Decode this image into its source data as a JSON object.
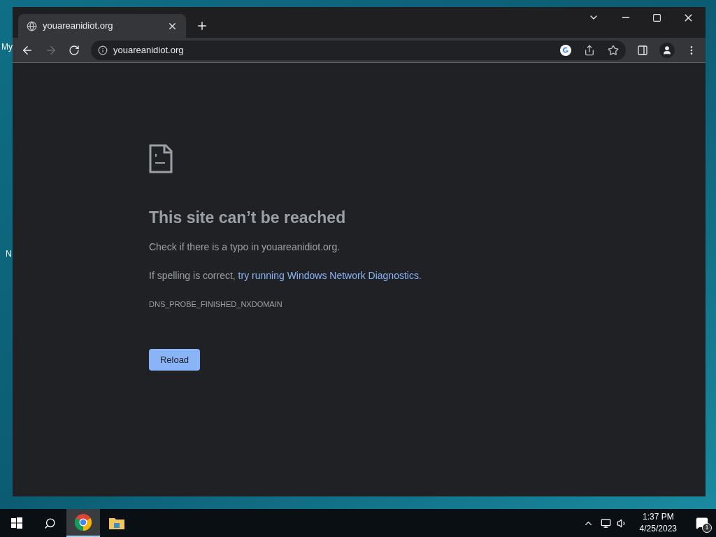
{
  "desktop": {
    "icon_labels": [
      "My",
      "N"
    ]
  },
  "browser": {
    "tabs": [
      {
        "title": "youareanidiot.org",
        "selected": true
      }
    ],
    "address_bar": {
      "url": "youareanidiot.org"
    },
    "forward_disabled": true,
    "error_page": {
      "heading": "This site can’t be reached",
      "line_1": "Check if there is a typo in youareanidiot.org.",
      "line_2_prefix": "If spelling is correct,",
      "line_2_link": "try running Windows Network Diagnostics",
      "line_2_suffix": ".",
      "error_code": "DNS_PROBE_FINISHED_NXDOMAIN",
      "button": "Reload"
    }
  },
  "taskbar": {
    "apps": [
      {
        "kind": "chrome",
        "selected": true
      },
      {
        "kind": "explorer",
        "selected": false
      }
    ],
    "clock": {
      "time": "1:37 PM",
      "date": "4/25/2023"
    },
    "notification_count": "1"
  }
}
